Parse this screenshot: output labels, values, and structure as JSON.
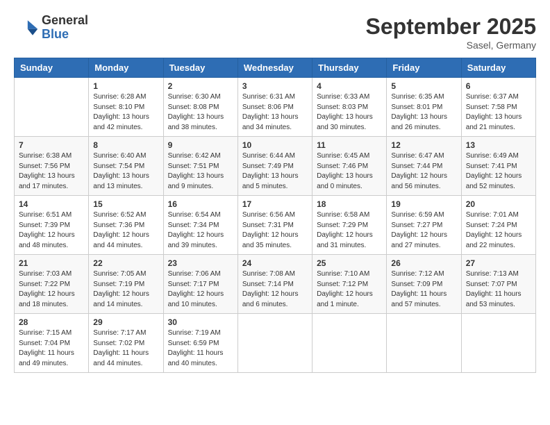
{
  "header": {
    "logo": {
      "general": "General",
      "blue": "Blue"
    },
    "title": "September 2025",
    "location": "Sasel, Germany"
  },
  "weekdays": [
    "Sunday",
    "Monday",
    "Tuesday",
    "Wednesday",
    "Thursday",
    "Friday",
    "Saturday"
  ],
  "weeks": [
    [
      {
        "day": null,
        "info": null
      },
      {
        "day": "1",
        "info": "Sunrise: 6:28 AM\nSunset: 8:10 PM\nDaylight: 13 hours\nand 42 minutes."
      },
      {
        "day": "2",
        "info": "Sunrise: 6:30 AM\nSunset: 8:08 PM\nDaylight: 13 hours\nand 38 minutes."
      },
      {
        "day": "3",
        "info": "Sunrise: 6:31 AM\nSunset: 8:06 PM\nDaylight: 13 hours\nand 34 minutes."
      },
      {
        "day": "4",
        "info": "Sunrise: 6:33 AM\nSunset: 8:03 PM\nDaylight: 13 hours\nand 30 minutes."
      },
      {
        "day": "5",
        "info": "Sunrise: 6:35 AM\nSunset: 8:01 PM\nDaylight: 13 hours\nand 26 minutes."
      },
      {
        "day": "6",
        "info": "Sunrise: 6:37 AM\nSunset: 7:58 PM\nDaylight: 13 hours\nand 21 minutes."
      }
    ],
    [
      {
        "day": "7",
        "info": "Sunrise: 6:38 AM\nSunset: 7:56 PM\nDaylight: 13 hours\nand 17 minutes."
      },
      {
        "day": "8",
        "info": "Sunrise: 6:40 AM\nSunset: 7:54 PM\nDaylight: 13 hours\nand 13 minutes."
      },
      {
        "day": "9",
        "info": "Sunrise: 6:42 AM\nSunset: 7:51 PM\nDaylight: 13 hours\nand 9 minutes."
      },
      {
        "day": "10",
        "info": "Sunrise: 6:44 AM\nSunset: 7:49 PM\nDaylight: 13 hours\nand 5 minutes."
      },
      {
        "day": "11",
        "info": "Sunrise: 6:45 AM\nSunset: 7:46 PM\nDaylight: 13 hours\nand 0 minutes."
      },
      {
        "day": "12",
        "info": "Sunrise: 6:47 AM\nSunset: 7:44 PM\nDaylight: 12 hours\nand 56 minutes."
      },
      {
        "day": "13",
        "info": "Sunrise: 6:49 AM\nSunset: 7:41 PM\nDaylight: 12 hours\nand 52 minutes."
      }
    ],
    [
      {
        "day": "14",
        "info": "Sunrise: 6:51 AM\nSunset: 7:39 PM\nDaylight: 12 hours\nand 48 minutes."
      },
      {
        "day": "15",
        "info": "Sunrise: 6:52 AM\nSunset: 7:36 PM\nDaylight: 12 hours\nand 44 minutes."
      },
      {
        "day": "16",
        "info": "Sunrise: 6:54 AM\nSunset: 7:34 PM\nDaylight: 12 hours\nand 39 minutes."
      },
      {
        "day": "17",
        "info": "Sunrise: 6:56 AM\nSunset: 7:31 PM\nDaylight: 12 hours\nand 35 minutes."
      },
      {
        "day": "18",
        "info": "Sunrise: 6:58 AM\nSunset: 7:29 PM\nDaylight: 12 hours\nand 31 minutes."
      },
      {
        "day": "19",
        "info": "Sunrise: 6:59 AM\nSunset: 7:27 PM\nDaylight: 12 hours\nand 27 minutes."
      },
      {
        "day": "20",
        "info": "Sunrise: 7:01 AM\nSunset: 7:24 PM\nDaylight: 12 hours\nand 22 minutes."
      }
    ],
    [
      {
        "day": "21",
        "info": "Sunrise: 7:03 AM\nSunset: 7:22 PM\nDaylight: 12 hours\nand 18 minutes."
      },
      {
        "day": "22",
        "info": "Sunrise: 7:05 AM\nSunset: 7:19 PM\nDaylight: 12 hours\nand 14 minutes."
      },
      {
        "day": "23",
        "info": "Sunrise: 7:06 AM\nSunset: 7:17 PM\nDaylight: 12 hours\nand 10 minutes."
      },
      {
        "day": "24",
        "info": "Sunrise: 7:08 AM\nSunset: 7:14 PM\nDaylight: 12 hours\nand 6 minutes."
      },
      {
        "day": "25",
        "info": "Sunrise: 7:10 AM\nSunset: 7:12 PM\nDaylight: 12 hours\nand 1 minute."
      },
      {
        "day": "26",
        "info": "Sunrise: 7:12 AM\nSunset: 7:09 PM\nDaylight: 11 hours\nand 57 minutes."
      },
      {
        "day": "27",
        "info": "Sunrise: 7:13 AM\nSunset: 7:07 PM\nDaylight: 11 hours\nand 53 minutes."
      }
    ],
    [
      {
        "day": "28",
        "info": "Sunrise: 7:15 AM\nSunset: 7:04 PM\nDaylight: 11 hours\nand 49 minutes."
      },
      {
        "day": "29",
        "info": "Sunrise: 7:17 AM\nSunset: 7:02 PM\nDaylight: 11 hours\nand 44 minutes."
      },
      {
        "day": "30",
        "info": "Sunrise: 7:19 AM\nSunset: 6:59 PM\nDaylight: 11 hours\nand 40 minutes."
      },
      {
        "day": null,
        "info": null
      },
      {
        "day": null,
        "info": null
      },
      {
        "day": null,
        "info": null
      },
      {
        "day": null,
        "info": null
      }
    ]
  ]
}
